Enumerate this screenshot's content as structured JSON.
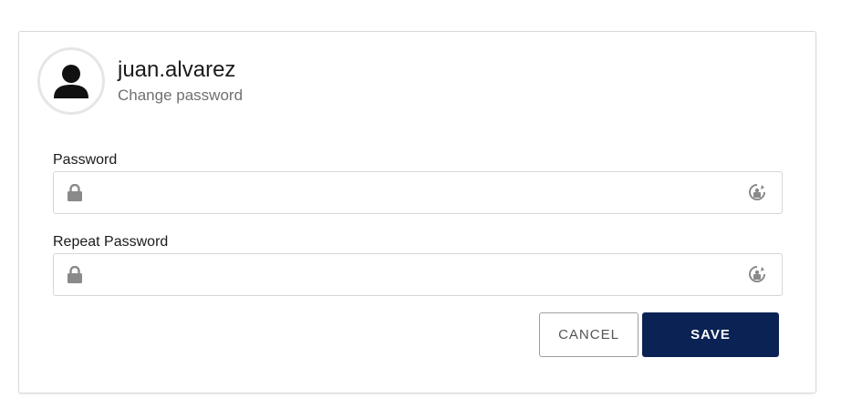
{
  "header": {
    "username": "juan.alvarez",
    "subtitle": "Change password",
    "avatar_icon": "user-icon"
  },
  "form": {
    "password": {
      "label": "Password",
      "value": "",
      "leading_icon": "lock-icon",
      "trailing_icon": "reveal-password-icon"
    },
    "repeat_password": {
      "label": "Repeat Password",
      "value": "",
      "leading_icon": "lock-icon",
      "trailing_icon": "reveal-password-icon"
    }
  },
  "actions": {
    "cancel_label": "CANCEL",
    "save_label": "SAVE"
  },
  "colors": {
    "primary": "#0b2255",
    "border": "#d6d6d6",
    "icon": "#8a8a8a"
  }
}
